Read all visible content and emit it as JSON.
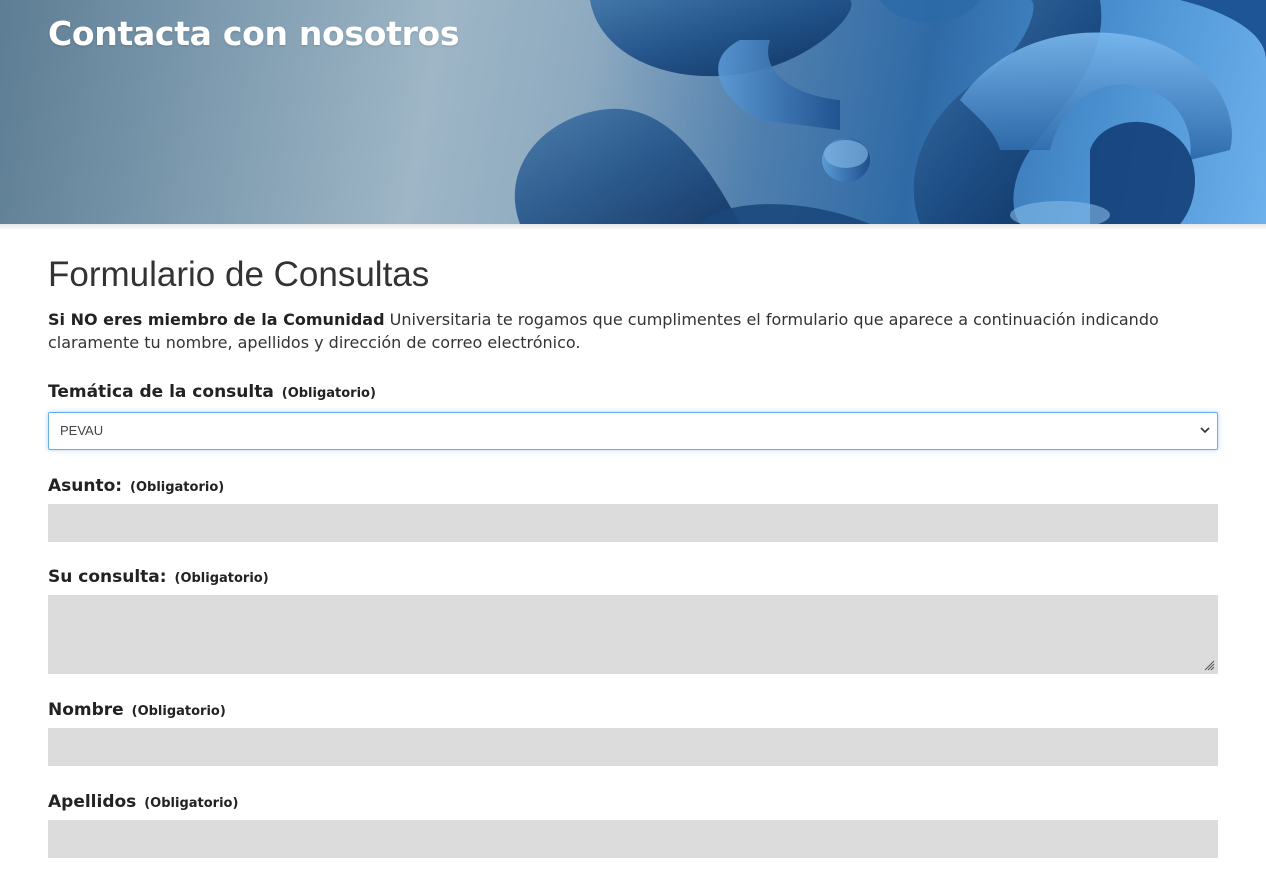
{
  "hero": {
    "title": "Contacta con nosotros"
  },
  "form": {
    "title": "Formulario de Consultas",
    "intro_bold": "Si NO eres miembro de la Comunidad",
    "intro_rest": " Universitaria te rogamos que cumplimentes el formulario que aparece a continuación indicando claramente tu nombre, apellidos y dirección de correo electrónico.",
    "required_tag": "(Obligatorio)",
    "fields": {
      "topic": {
        "label": "Temática de la consulta",
        "value": "PEVAU"
      },
      "subject": {
        "label": "Asunto:",
        "value": ""
      },
      "query": {
        "label": "Su consulta:",
        "value": ""
      },
      "name": {
        "label": "Nombre",
        "value": ""
      },
      "surname": {
        "label": "Apellidos",
        "value": ""
      }
    }
  },
  "colors": {
    "input_background": "#dcdcdc",
    "focus_border": "#66afe9",
    "hero_accent": "#2f6aa6"
  },
  "icons": {
    "select_arrow": "chevron-down-icon",
    "textarea_resize": "resize-grip-icon"
  }
}
